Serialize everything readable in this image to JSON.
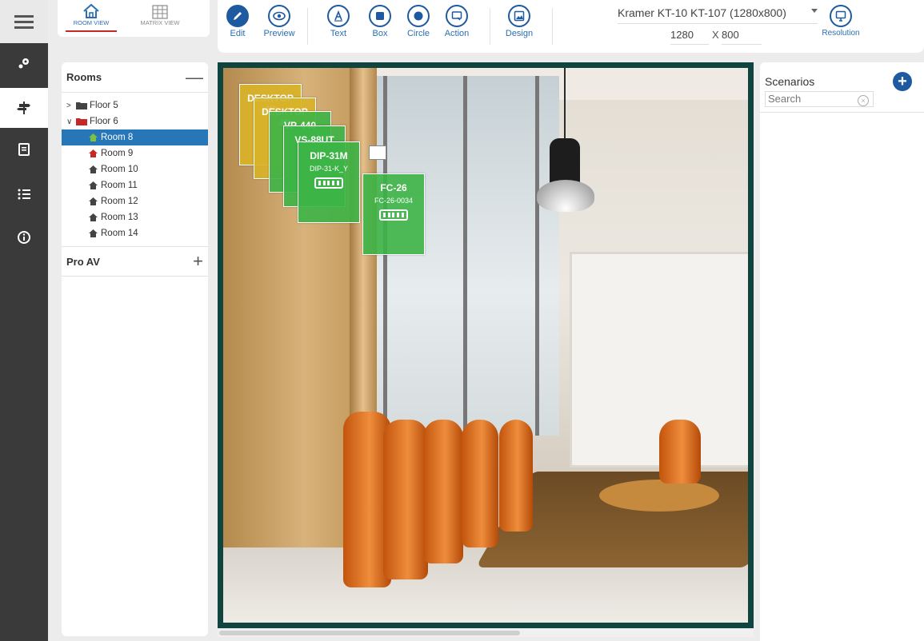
{
  "view_tabs": [
    {
      "label": "ROOM VIEW",
      "icon": "home-icon",
      "active": true
    },
    {
      "label": "MATRIX VIEW",
      "icon": "grid-icon",
      "active": false
    }
  ],
  "toolbar": {
    "tools": [
      {
        "label": "Edit",
        "icon": "pencil-icon"
      },
      {
        "label": "Preview",
        "icon": "eye-icon"
      },
      {
        "label": "Text",
        "icon": "text-icon"
      },
      {
        "label": "Box",
        "icon": "square-icon"
      },
      {
        "label": "Circle",
        "icon": "circle-icon"
      },
      {
        "label": "Action",
        "icon": "action-icon"
      },
      {
        "label": "Design",
        "icon": "image-icon"
      }
    ],
    "device": "Kramer KT-10 KT-107 (1280x800)",
    "width": "1280",
    "x_label": "X",
    "height": "800",
    "resolution_label": "Resolution"
  },
  "rooms_panel": {
    "title": "Rooms",
    "floors": [
      {
        "label": "Floor 5",
        "expanded": false
      },
      {
        "label": "Floor 6",
        "expanded": true
      }
    ],
    "rooms": [
      {
        "label": "Room 8",
        "selected": true,
        "icon_color": "#7cc242"
      },
      {
        "label": "Room 9",
        "selected": false,
        "icon_color": "#c62828"
      },
      {
        "label": "Room 10",
        "selected": false,
        "icon_color": "#444444"
      },
      {
        "label": "Room 11",
        "selected": false,
        "icon_color": "#444444"
      },
      {
        "label": "Room 12",
        "selected": false,
        "icon_color": "#444444"
      },
      {
        "label": "Room 13",
        "selected": false,
        "icon_color": "#444444"
      },
      {
        "label": "Room 14",
        "selected": false,
        "icon_color": "#444444"
      }
    ],
    "pro_av": "Pro AV"
  },
  "cards": [
    {
      "title": "DESKTOP 4B",
      "sub": "",
      "color": "yellow"
    },
    {
      "title": "DESKTOP 4B",
      "sub": "",
      "color": "yellow"
    },
    {
      "title": "VP-440",
      "sub": "",
      "color": "green"
    },
    {
      "title": "VS-88UT",
      "sub": "",
      "color": "green"
    },
    {
      "title": "DIP-31M",
      "sub": "DIP-31-K_Y",
      "color": "green"
    },
    {
      "title": "FC-26",
      "sub": "FC-26-0034",
      "color": "green"
    }
  ],
  "scenarios": {
    "title": "Scenarios",
    "search_placeholder": "Search"
  },
  "colors": {
    "accent": "#1e5aa0",
    "selected": "#2676b8",
    "rail": "#3a3a3a",
    "canvas_border": "#10443e"
  }
}
